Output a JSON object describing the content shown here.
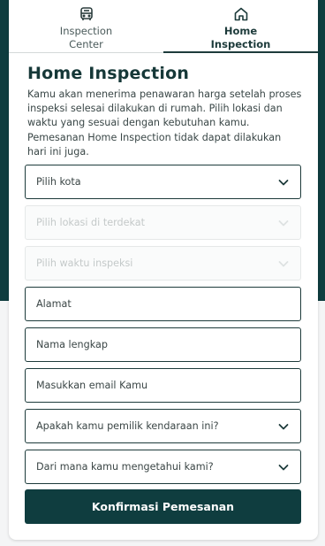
{
  "tabs": [
    {
      "label": "Inspection Center",
      "icon": "bus-icon",
      "active": false
    },
    {
      "label": "Home Inspection",
      "icon": "home-icon",
      "active": true
    }
  ],
  "main": {
    "title": "Home Inspection",
    "description": "Kamu akan menerima penawaran harga setelah proses inspeksi selesai dilakukan di rumah. Pilih lokasi dan waktu yang sesuai dengan kebutuhan kamu. Pemesanan Home Inspection tidak dapat dilakukan hari ini juga."
  },
  "form": {
    "city_select": "Pilih kota",
    "location_select": "Pilih lokasi di terdekat",
    "time_select": "Pilih waktu inspeksi",
    "address_placeholder": "Alamat",
    "name_placeholder": "Nama lengkap",
    "email_placeholder": "Masukkan email Kamu",
    "owner_select": "Apakah kamu pemilik kendaraan ini?",
    "source_select": "Dari mana kamu mengetahui kami?",
    "confirm_label": "Konfirmasi Pemesanan"
  },
  "colors": {
    "brand_dark": "#0f3d3f",
    "text_dark": "#1d3b3b"
  }
}
